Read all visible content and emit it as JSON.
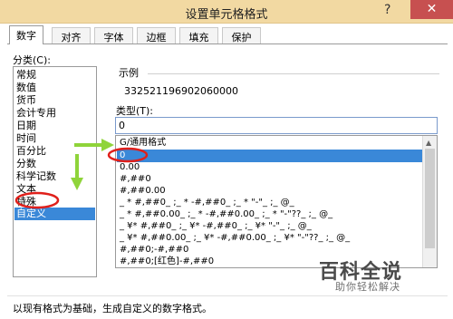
{
  "window": {
    "title": "设置单元格格式",
    "help": "?",
    "close": "✕"
  },
  "tabs": [
    "数字",
    "对齐",
    "字体",
    "边框",
    "填充",
    "保护"
  ],
  "category_label": "分类(C):",
  "categories": [
    "常规",
    "数值",
    "货币",
    "会计专用",
    "日期",
    "时间",
    "百分比",
    "分数",
    "科学记数",
    "文本",
    "特殊",
    "自定义"
  ],
  "selected_category": "自定义",
  "sample": {
    "label": "示例",
    "value": "332521196902060000"
  },
  "type_field": {
    "label": "类型(T):",
    "value": "0"
  },
  "formats": [
    "G/通用格式",
    "0",
    "0.00",
    "#,##0",
    "#,##0.00",
    "_ * #,##0_ ;_ * -#,##0_ ;_ * \"-\"_ ;_ @_",
    "_ * #,##0.00_ ;_ * -#,##0.00_ ;_ * \"-\"??_ ;_ @_",
    "_ ¥* #,##0_ ;_ ¥* -#,##0_ ;_ ¥* \"-\"_ ;_ @_",
    "_ ¥* #,##0.00_ ;_ ¥* -#,##0.00_ ;_ ¥* \"-\"??_ ;_ @_",
    "#,##0;-#,##0",
    "#,##0;[红色]-#,##0"
  ],
  "selected_format": "0",
  "watermark": {
    "title": "百科全说",
    "subtitle": "助你轻松解决"
  },
  "description": "以现有格式为基础，生成自定义的数字格式。",
  "annotation_color": "#e0201b",
  "arrow_color": "#8fd43a",
  "selection_color": "#3a88d8"
}
